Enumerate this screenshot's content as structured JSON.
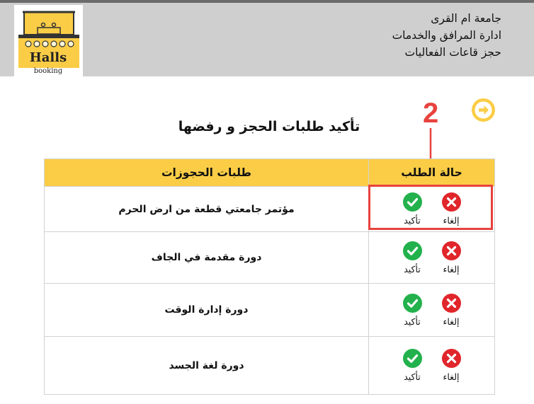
{
  "header": {
    "logo": {
      "title": "Halls",
      "subtitle": "booking"
    },
    "lines": [
      "جامعة ام القرى",
      "ادارة المرافق والخدمات",
      "حجز قاعات الفعاليات"
    ]
  },
  "page": {
    "title": "تأكيد طلبات الحجز و رفضها"
  },
  "annotation": {
    "number": "2"
  },
  "table": {
    "headers": {
      "status": "حالة الطلب",
      "requests": "طلبات الحجوزات"
    },
    "actions": {
      "cancel": "إلغاء",
      "confirm": "تأكيد"
    },
    "rows": [
      {
        "name": "مؤتمر جامعتي قطعة من ارض الحرم"
      },
      {
        "name": "دورة مقدمة في الجاف"
      },
      {
        "name": "دورة إدارة الوقت"
      },
      {
        "name": "دورة لغة الجسد"
      }
    ]
  },
  "colors": {
    "accent": "#fbcd46",
    "confirm": "#22b14c",
    "cancel": "#e0262b",
    "annotation": "#e8423d",
    "header_bg": "#cfcfcf"
  }
}
